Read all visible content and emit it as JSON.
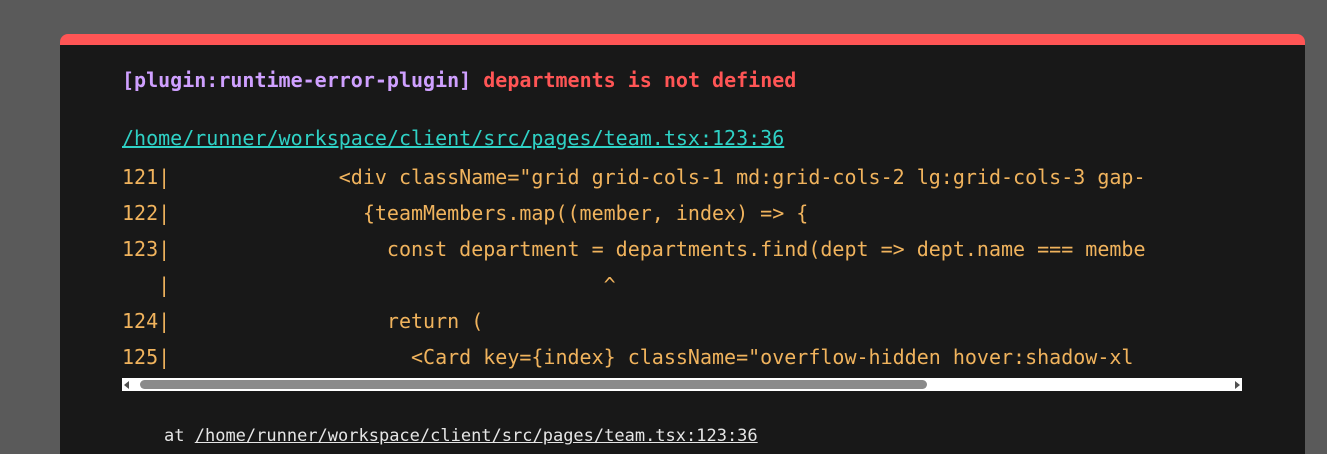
{
  "error": {
    "plugin": "[plugin:runtime-error-plugin]",
    "message": "departments is not defined",
    "file_link": "/home/runner/workspace/client/src/pages/team.tsx:123:36"
  },
  "frame_lines": [
    "121|              <div className=\"grid grid-cols-1 md:grid-cols-2 lg:grid-cols-3 gap-",
    "122|                {teamMembers.map((member, index) => {",
    "123|                  const department = departments.find(dept => dept.name === membe",
    "   |                                    ^",
    "124|                  return (",
    "125|                    <Card key={index} className=\"overflow-hidden hover:shadow-xl"
  ],
  "stack": {
    "prefix": "at",
    "location": "/home/runner/workspace/client/src/pages/team.tsx:123:36"
  },
  "colors": {
    "accent_bar": "#ff5555",
    "plugin_text": "#cfa0ff",
    "message_text": "#ff5555",
    "link": "#2fd1c5",
    "code_text": "#f0b35d",
    "background": "#181818"
  }
}
